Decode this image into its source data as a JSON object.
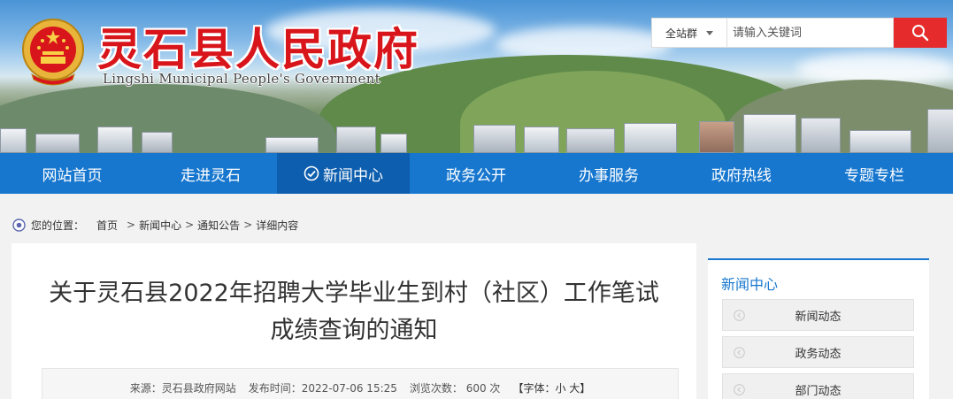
{
  "header": {
    "title": "灵石县人民政府",
    "subtitle": "Lingshi Municipal People's Government",
    "search": {
      "scope": "全站群",
      "placeholder": "请输入关键词"
    }
  },
  "nav": {
    "items": [
      {
        "label": "网站首页"
      },
      {
        "label": "走进灵石"
      },
      {
        "label": "新闻中心"
      },
      {
        "label": "政务公开"
      },
      {
        "label": "办事服务"
      },
      {
        "label": "政府热线"
      },
      {
        "label": "专题专栏"
      }
    ],
    "active": "新闻中心"
  },
  "breadcrumb": {
    "prefix": "您的位置：",
    "items": [
      "首页",
      "新闻中心",
      "通知公告",
      "详细内容"
    ],
    "separator": ">"
  },
  "article": {
    "title": "关于灵石县2022年招聘大学毕业生到村（社区）工作笔试成绩查询的通知",
    "meta": {
      "source": "来源：灵石县政府网站",
      "date": "发布时间：2022-07-06 15:25",
      "views": "浏览次数： 600  次",
      "font": "【字体：小 大】"
    }
  },
  "sidebar": {
    "title": "新闻中心",
    "items": [
      {
        "label": "新闻动态"
      },
      {
        "label": "政务动态"
      },
      {
        "label": "部门动态"
      }
    ]
  },
  "colors": {
    "brand_red": "#d8151b",
    "nav_blue": "#1777cf",
    "nav_active": "#0d5eae",
    "search_button": "#e52b2b"
  }
}
